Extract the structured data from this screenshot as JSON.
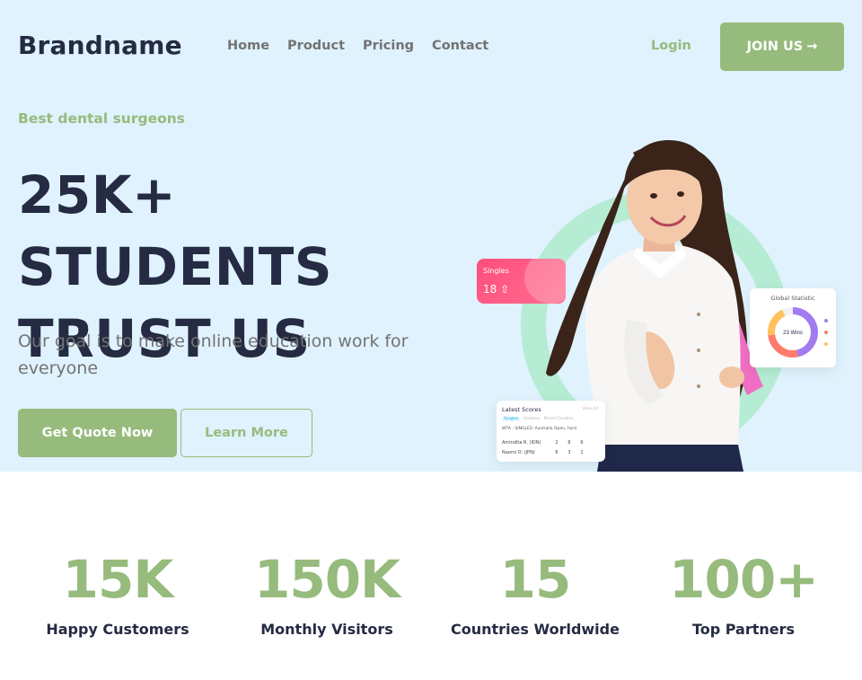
{
  "header": {
    "brand": "Brandname",
    "nav": [
      {
        "label": "Home"
      },
      {
        "label": "Product"
      },
      {
        "label": "Pricing"
      },
      {
        "label": "Contact"
      }
    ],
    "login_label": "Login",
    "join_label": "JOIN US",
    "join_arrow": "→"
  },
  "hero": {
    "tagline": "Best dental surgeons",
    "headline_line1": "25K+ STUDENTS",
    "headline_line2": "TRUST US",
    "subtext": "Our goal is to make online education work for everyone",
    "primary_button": "Get Quote Now",
    "secondary_button": "Learn More"
  },
  "cards": {
    "singles": {
      "label": "Singles",
      "value": "18",
      "icon": "up-arrow-icon"
    },
    "global_statistic": {
      "title": "Global Statistic",
      "center": "23 Wins"
    },
    "latest_scores": {
      "title": "Latest Scores",
      "view_all": "View All",
      "tabs": [
        "Singles",
        "Doubles",
        "Mixed Doubles"
      ],
      "event": "WTA - SINGLES: Australia Open, hard",
      "rows": [
        {
          "name": "Amindita R. (IDN)",
          "s1": "2",
          "s2": "6",
          "s3": "6"
        },
        {
          "name": "Naomi O. (JPN)",
          "s1": "6",
          "s2": "3",
          "s3": "1"
        }
      ]
    }
  },
  "stats": [
    {
      "value": "15K",
      "label": "Happy Customers"
    },
    {
      "value": "150K",
      "label": "Monthly Visitors"
    },
    {
      "value": "15",
      "label": "Countries Worldwide"
    },
    {
      "value": "100+",
      "label": "Top Partners"
    }
  ],
  "colors": {
    "accent": "#96bb7c",
    "hero_bg": "#dff2fd",
    "heading": "#252b42",
    "muted": "#737373",
    "ring": "#b5ecd3",
    "singles_card": "#ff4d7d"
  }
}
